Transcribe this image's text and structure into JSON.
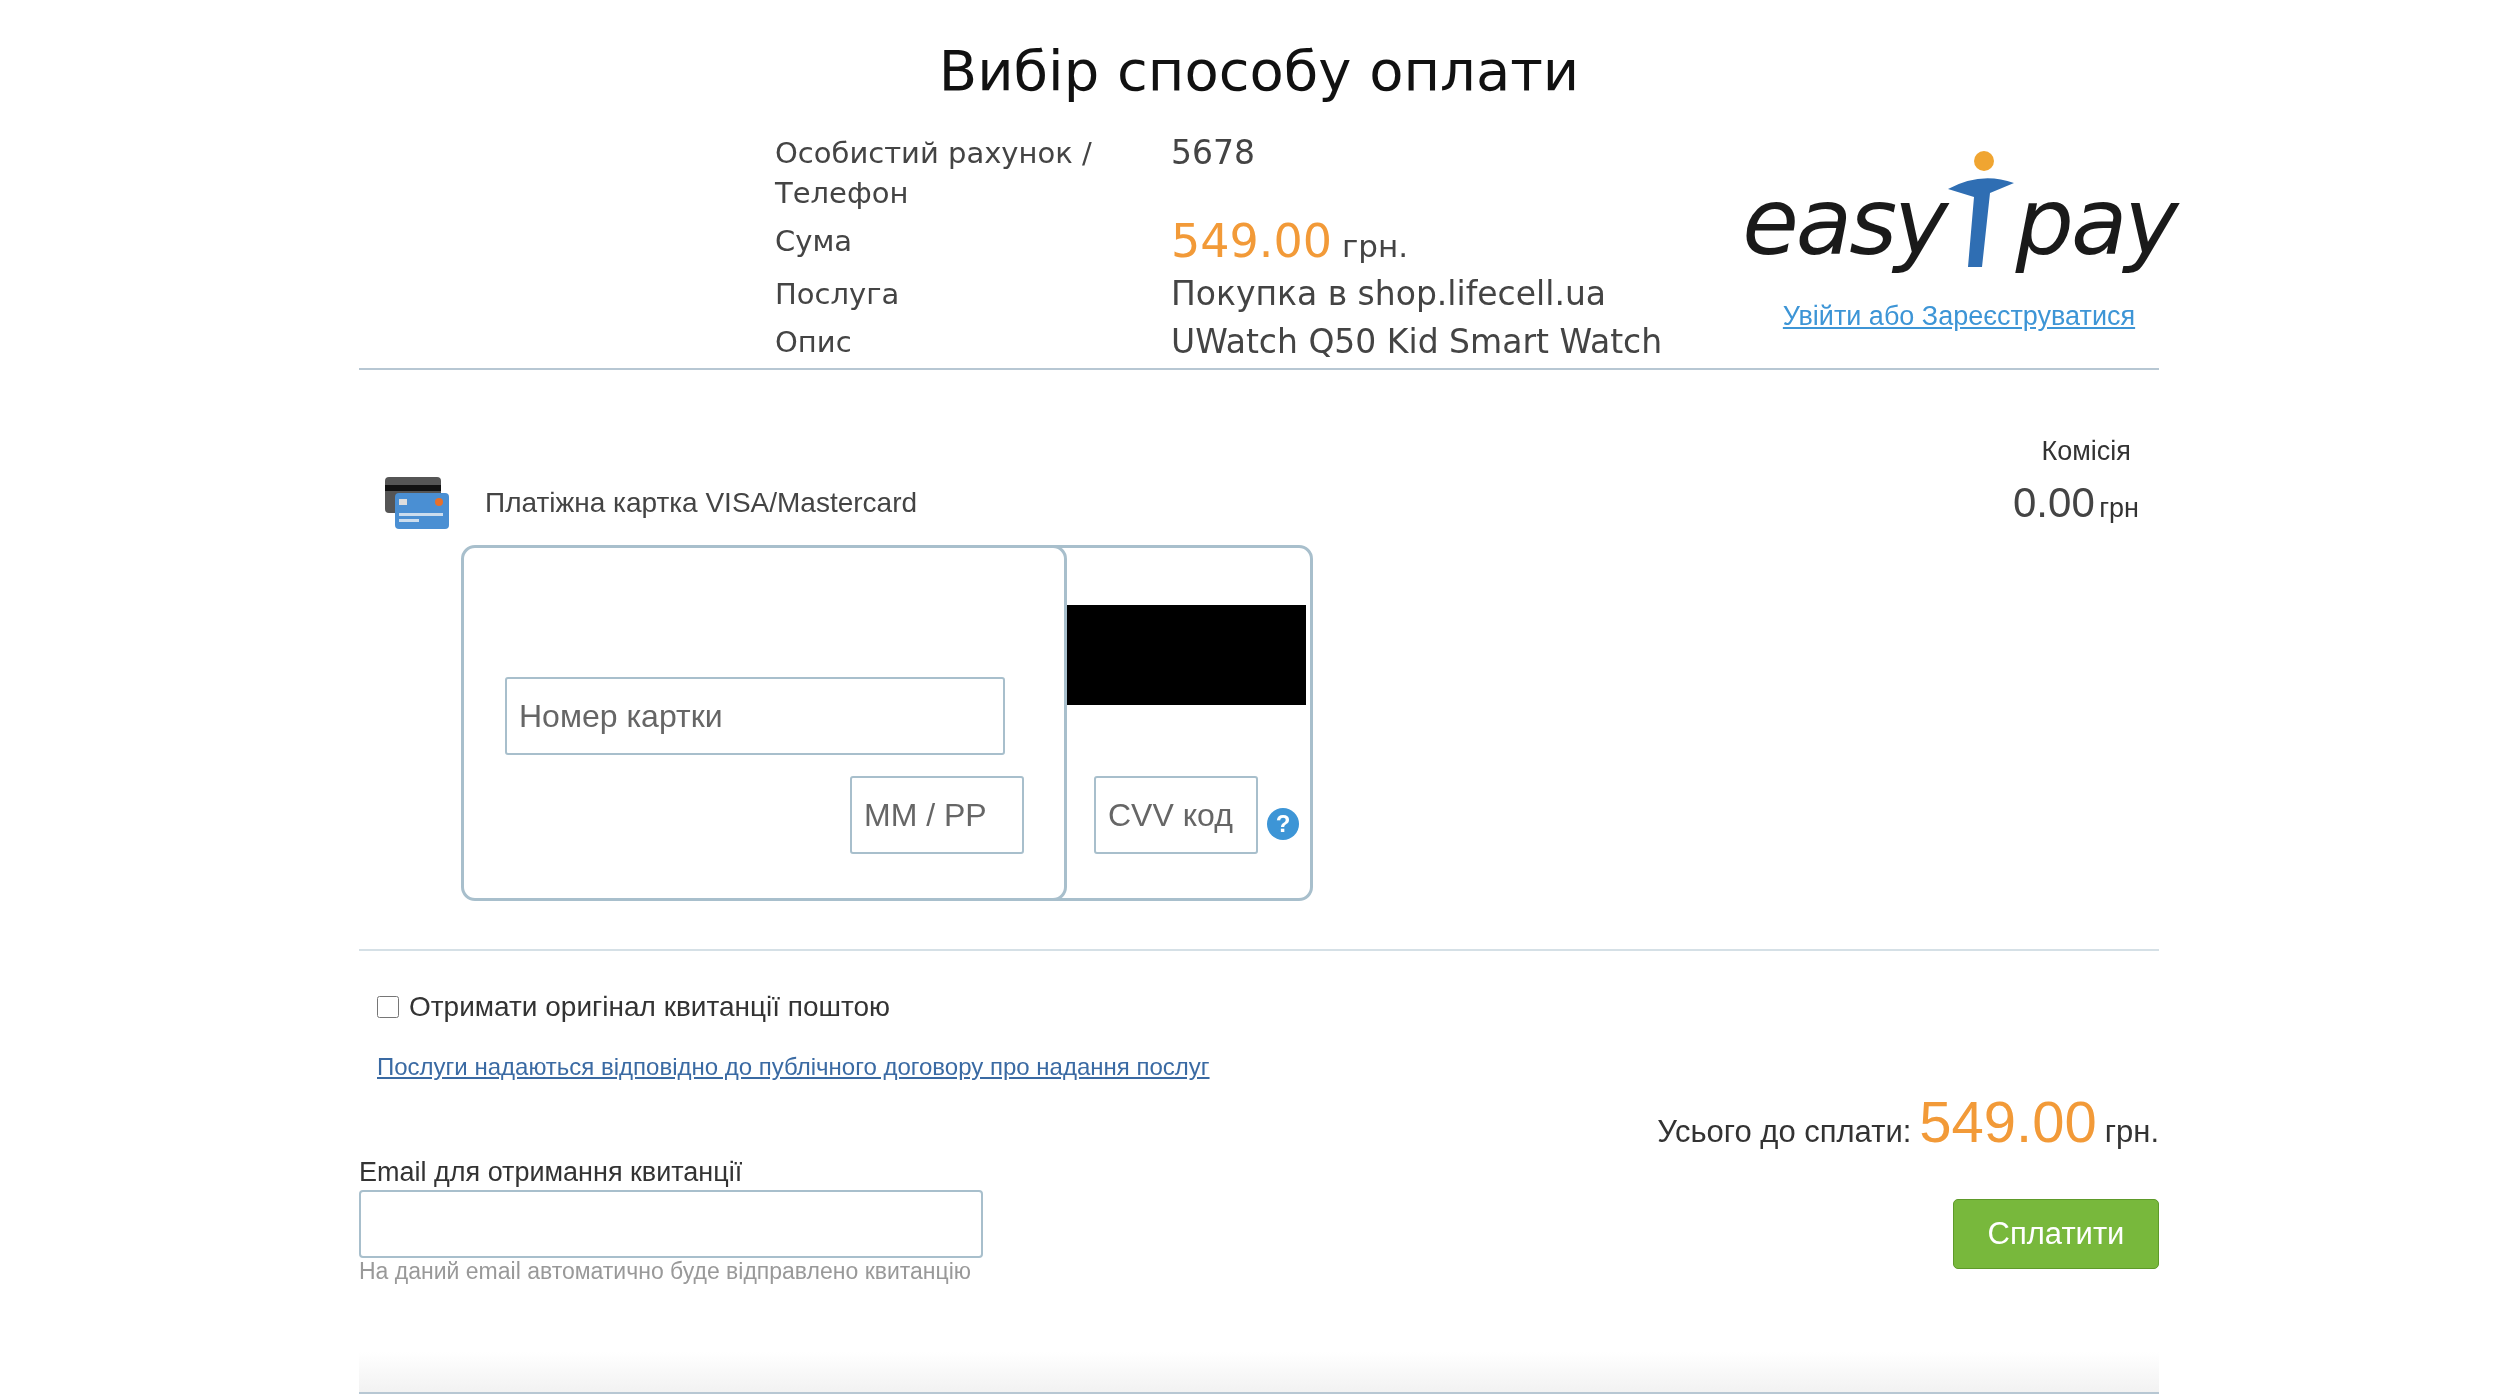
{
  "title": "Вибір способу оплати",
  "details": [
    {
      "label": "Особистий рахунок / Телефон",
      "value": "5678",
      "kind": "text"
    },
    {
      "label": "Сума",
      "value": "549.00",
      "unit": "грн.",
      "kind": "amount"
    },
    {
      "label": "Послуга",
      "value": "Покупка в shop.lifecell.ua",
      "kind": "text"
    },
    {
      "label": "Опис",
      "value": "UWatch Q50 Kid Smart Watch",
      "kind": "text"
    }
  ],
  "logo": {
    "left": "easy",
    "right": "pay"
  },
  "login_link": "Увійти або Зареєструватися",
  "commission": {
    "label": "Комісія",
    "value": "0.00",
    "unit": "грн"
  },
  "method": {
    "label": "Платіжна картка VISA/Mastercard"
  },
  "card": {
    "number_placeholder": "Номер картки",
    "expiry_placeholder": "ММ / РР",
    "cvv_placeholder": "CVV код",
    "help": "?"
  },
  "mail_receipt": {
    "label": "Отримати оригінал квитанції поштою",
    "checked": false
  },
  "terms_link": "Послуги надаються відповідно до публічного договору про надання послуг",
  "total": {
    "label": "Усього до сплати:",
    "value": "549.00",
    "unit": "грн."
  },
  "email": {
    "label": "Email для отримання квитанції",
    "hint": "На даний email автоматично буде відправлено квитанцію"
  },
  "pay_button": "Сплатити"
}
